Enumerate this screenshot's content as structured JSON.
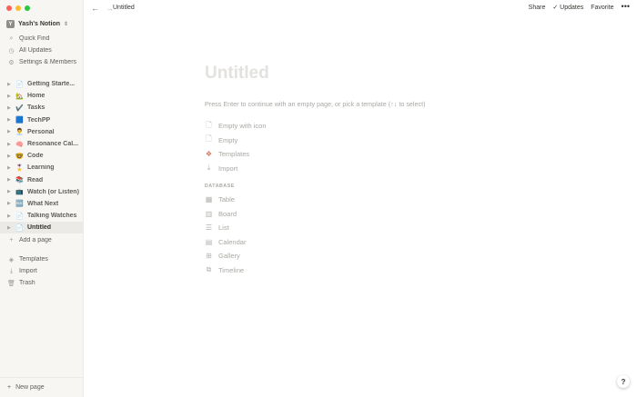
{
  "colors": {
    "close": "#fe5f57",
    "minimize": "#febc2e",
    "zoom": "#28c840",
    "sidebar_bg": "#f7f6f3"
  },
  "sidebar": {
    "workspace": {
      "avatar": "Y",
      "name": "Yash's Notion"
    },
    "quick_links": [
      {
        "icon": "search-icon",
        "glyph": "⌕",
        "label": "Quick Find"
      },
      {
        "icon": "clock-icon",
        "glyph": "◷",
        "label": "All Updates"
      },
      {
        "icon": "gear-icon",
        "glyph": "⚙",
        "label": "Settings & Members"
      }
    ],
    "pages": [
      {
        "emoji": "📄",
        "label": "Getting Starte..."
      },
      {
        "emoji": "🏡",
        "label": "Home"
      },
      {
        "emoji": "✔️",
        "label": "Tasks"
      },
      {
        "emoji": "🟦",
        "label": "TechPP"
      },
      {
        "emoji": "👨‍💼",
        "label": "Personal"
      },
      {
        "emoji": "🧠",
        "label": "Resonance Cal..."
      },
      {
        "emoji": "🤓",
        "label": "Code"
      },
      {
        "emoji": "🎖️",
        "label": "Learning"
      },
      {
        "emoji": "📚",
        "label": "Read"
      },
      {
        "emoji": "📺",
        "label": "Watch (or Listen)"
      },
      {
        "emoji": "🆕",
        "label": "What Next"
      },
      {
        "emoji": "📄",
        "label": "Talking Watches"
      },
      {
        "emoji": "📄",
        "label": "Untitled"
      }
    ],
    "add_page": "Add a page",
    "bottom_links": [
      {
        "icon": "templates-icon",
        "glyph": "◈",
        "label": "Templates"
      },
      {
        "icon": "import-icon",
        "glyph": "⤓",
        "label": "Import"
      },
      {
        "icon": "trash-icon",
        "glyph": "🗑",
        "label": "Trash"
      }
    ],
    "new_page": "New page"
  },
  "topbar": {
    "breadcrumb": "Untitled",
    "share": "Share",
    "updates": "Updates",
    "favorite": "Favorite",
    "more": "•••"
  },
  "page": {
    "title_placeholder": "Untitled",
    "hint": "Press Enter to continue with an empty page, or pick a template (↑↓ to select)",
    "options": [
      {
        "icon": "page-icon",
        "glyph": "🗋",
        "label": "Empty with icon"
      },
      {
        "icon": "page-icon",
        "glyph": "🗋",
        "label": "Empty"
      },
      {
        "icon": "templates-icon",
        "glyph": "❖",
        "label": "Templates"
      },
      {
        "icon": "import-icon",
        "glyph": "⤓",
        "label": "Import"
      }
    ],
    "database_heading": "DATABASE",
    "database_options": [
      {
        "icon": "table-icon",
        "glyph": "▦",
        "label": "Table"
      },
      {
        "icon": "board-icon",
        "glyph": "▥",
        "label": "Board"
      },
      {
        "icon": "list-icon",
        "glyph": "☰",
        "label": "List"
      },
      {
        "icon": "calendar-icon",
        "glyph": "▤",
        "label": "Calendar"
      },
      {
        "icon": "gallery-icon",
        "glyph": "⊞",
        "label": "Gallery"
      },
      {
        "icon": "timeline-icon",
        "glyph": "⧉",
        "label": "Timeline"
      }
    ]
  },
  "help": "?"
}
